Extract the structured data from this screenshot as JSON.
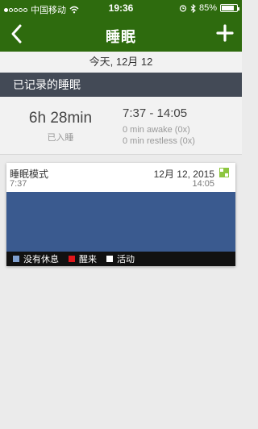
{
  "status_bar": {
    "carrier": "中国移动",
    "time": "19:36",
    "battery": "85%",
    "battery_level": 0.85,
    "signal_bars": 1
  },
  "nav": {
    "title": "睡眠",
    "back_icon": "chevron-left-icon",
    "add_icon": "plus-icon"
  },
  "date_label": "今天, 12月 12",
  "section_header": "已记录的睡眠",
  "summary": {
    "duration": "6h 28min",
    "duration_label": "已入睡",
    "range": "7:37 - 14:05",
    "awake": "0 min awake (0x)",
    "restless": "0 min restless (0x)"
  },
  "card": {
    "title": "睡眠模式",
    "start_time": "7:37",
    "date": "12月 12, 2015",
    "end_time": "14:05",
    "badge_color": "#8dc63f"
  },
  "chart_data": {
    "type": "area",
    "x": [
      "7:37",
      "14:05"
    ],
    "series": [
      {
        "name": "没有休息",
        "state": "sleep",
        "color": "#3a5a8f",
        "values": [
          1,
          1
        ]
      }
    ],
    "ylim": [
      0,
      1
    ]
  },
  "legend": [
    {
      "label": "没有休息",
      "color": "#7f9fcf"
    },
    {
      "label": "醒来",
      "color": "#e0161b"
    },
    {
      "label": "活动",
      "color": "#ffffff"
    }
  ]
}
